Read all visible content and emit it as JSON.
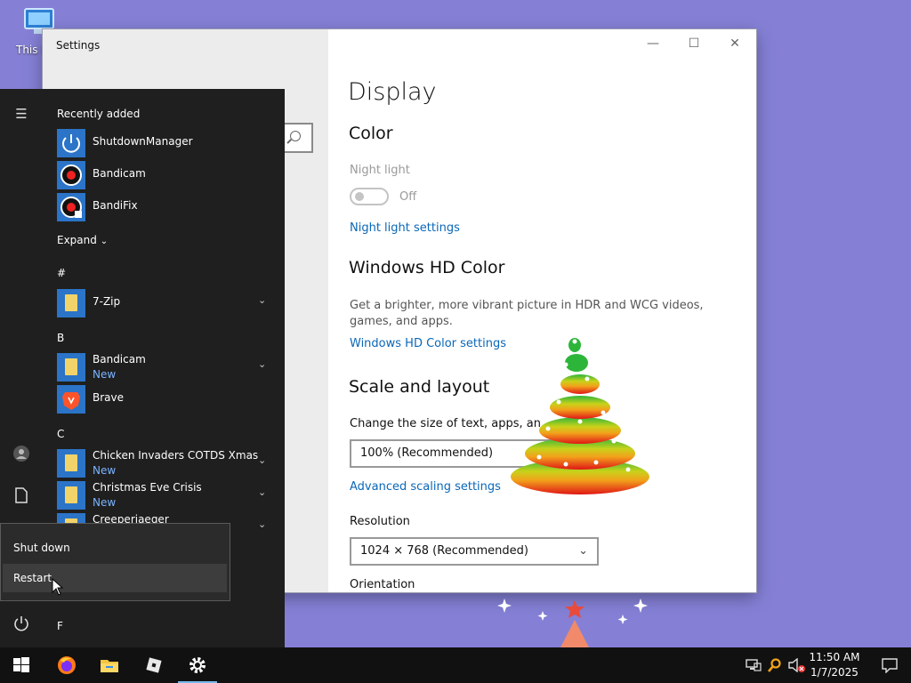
{
  "desktop": {
    "icon_label": "This PC"
  },
  "settings": {
    "window_title": "Settings",
    "controls": {
      "minimize": "—",
      "maximize": "☐",
      "close": "✕"
    },
    "page_title": "Display",
    "color": {
      "heading": "Color",
      "night_light_label": "Night light",
      "night_light_state": "Off",
      "night_light_link": "Night light settings"
    },
    "hd_color": {
      "heading": "Windows HD Color",
      "description": "Get a brighter, more vibrant picture in HDR and WCG videos, games, and apps.",
      "link": "Windows HD Color settings"
    },
    "scale": {
      "heading": "Scale and layout",
      "change_size_label": "Change the size of text, apps, an",
      "scale_value": "100% (Recommended)",
      "advanced_link": "Advanced scaling settings",
      "resolution_label": "Resolution",
      "resolution_value": "1024 × 768 (Recommended)",
      "orientation_label": "Orientation"
    }
  },
  "start_menu": {
    "recently_added_label": "Recently added",
    "recent": [
      {
        "name": "ShutdownManager"
      },
      {
        "name": "Bandicam"
      },
      {
        "name": "BandiFix"
      }
    ],
    "expand_label": "Expand",
    "groups": [
      {
        "letter": "#",
        "apps": [
          {
            "name": "7-Zip",
            "badge": ""
          }
        ]
      },
      {
        "letter": "B",
        "apps": [
          {
            "name": "Bandicam",
            "badge": "New"
          },
          {
            "name": "Brave",
            "badge": ""
          }
        ]
      },
      {
        "letter": "C",
        "apps": [
          {
            "name": "Chicken Invaders COTDS Xmas",
            "badge": "New"
          },
          {
            "name": "Christmas Eve Crisis",
            "badge": "New"
          },
          {
            "name": "Creeperjaeger",
            "badge": ""
          }
        ]
      },
      {
        "letter": "F",
        "apps": []
      }
    ],
    "power_menu": {
      "shut_down": "Shut down",
      "restart": "Restart"
    }
  },
  "taskbar": {
    "apps": [
      "start-icon",
      "firefox-icon",
      "file-explorer-icon",
      "roblox-icon",
      "settings-icon"
    ],
    "time": "11:50 AM",
    "date": "1/7/2025"
  },
  "colors": {
    "accent": "#2b74c8",
    "link": "#0a67b8",
    "start_bg": "#1f1f1f",
    "desktop_bg": "#8580d6",
    "new_badge": "#79b4ff"
  }
}
